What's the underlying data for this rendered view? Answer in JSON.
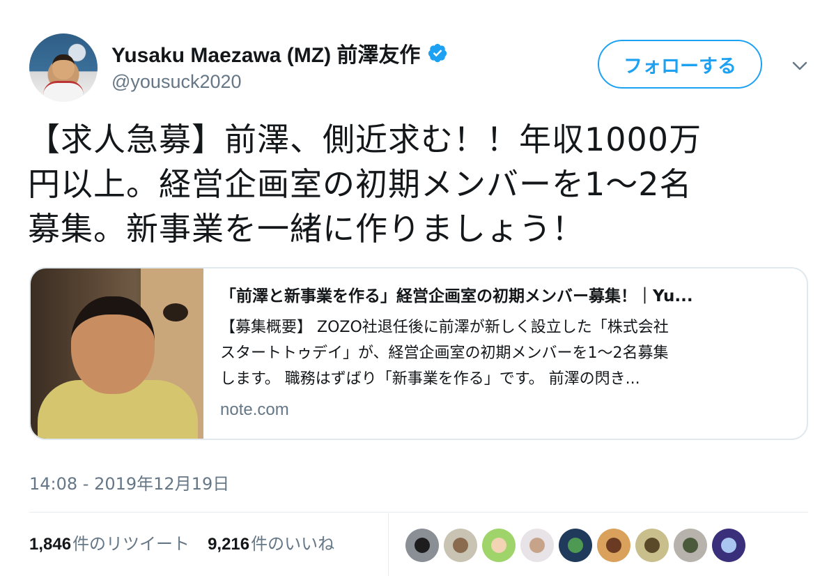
{
  "user": {
    "display_name": "Yusaku Maezawa (MZ) 前澤友作",
    "handle": "@yousuck2020",
    "verified_icon": "verified-badge-icon"
  },
  "actions": {
    "follow_label": "フォローする",
    "more_icon": "chevron-down-icon"
  },
  "tweet": {
    "text_lines": [
      "【求人急募】前澤、側近求む！！年収1000万",
      "円以上。経営企画室の初期メンバーを1〜2名",
      "募集。新事業を一緒に作りましょう！"
    ]
  },
  "card": {
    "title": "「前澤と新事業を作る」経営企画室の初期メンバー募集！｜Yu...",
    "description_lines": [
      "【募集概要】 ZOZO社退任後に前澤が新しく設立した「株式会社",
      "スタートトゥデイ」が、経営企画室の初期メンバーを1〜2名募集",
      "します。 職務はずばり「新事業を作る」です。 前澤の閃き..."
    ],
    "domain": "note.com"
  },
  "timestamp": "14:08 - 2019年12月19日",
  "stats": {
    "retweets_count": "1,846",
    "retweets_label": "件のリツイート",
    "likes_count": "9,216",
    "likes_label": "件のいいね"
  },
  "colors": {
    "accent": "#1da1f2",
    "secondary_text": "#657786",
    "border": "#e1e8ed"
  }
}
